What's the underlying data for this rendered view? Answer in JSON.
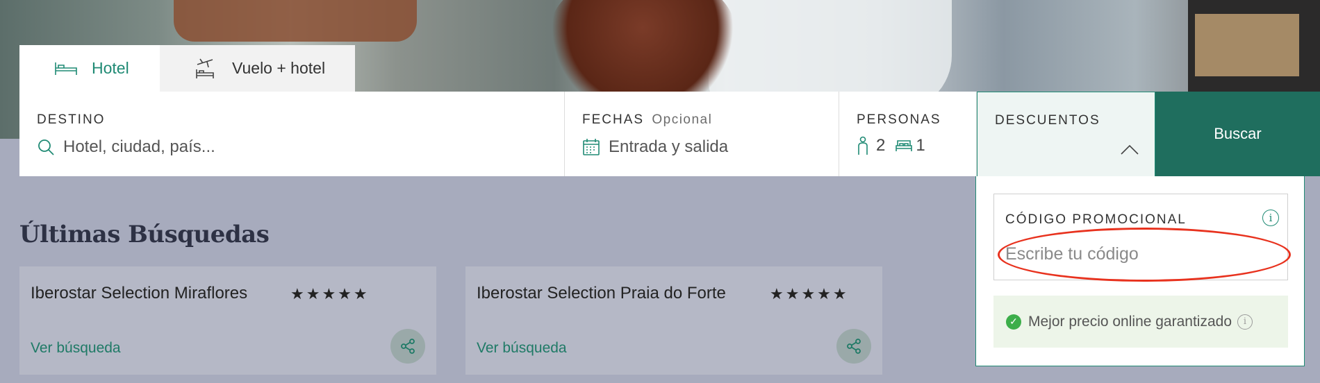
{
  "tabs": [
    {
      "label": "Hotel",
      "icon": "bed-icon"
    },
    {
      "label": "Vuelo + hotel",
      "icon": "plane-bed-icon"
    }
  ],
  "search": {
    "destination": {
      "label": "DESTINO",
      "placeholder": "Hotel, ciudad, país..."
    },
    "dates": {
      "label": "FECHAS",
      "optional": "Opcional",
      "value": "Entrada y salida"
    },
    "people": {
      "label": "PERSONAS",
      "adults": "2",
      "rooms": "1"
    },
    "discounts": {
      "label": "DESCUENTOS"
    },
    "button": "Buscar"
  },
  "discounts_panel": {
    "promo_label": "CÓDIGO PROMOCIONAL",
    "promo_placeholder": "Escribe tu código",
    "info_glyph": "i",
    "best_price": "Mejor precio online garantizado"
  },
  "recent": {
    "title": "Últimas Búsquedas",
    "items": [
      {
        "name": "Iberostar Selection Miraflores",
        "stars": "★★★★★",
        "link": "Ver búsqueda"
      },
      {
        "name": "Iberostar Selection Praia do Forte",
        "stars": "★★★★★",
        "link": "Ver búsqueda"
      }
    ]
  },
  "colors": {
    "accent": "#1f8a74",
    "button": "#1f6e5e",
    "highlight": "#e8321e"
  }
}
